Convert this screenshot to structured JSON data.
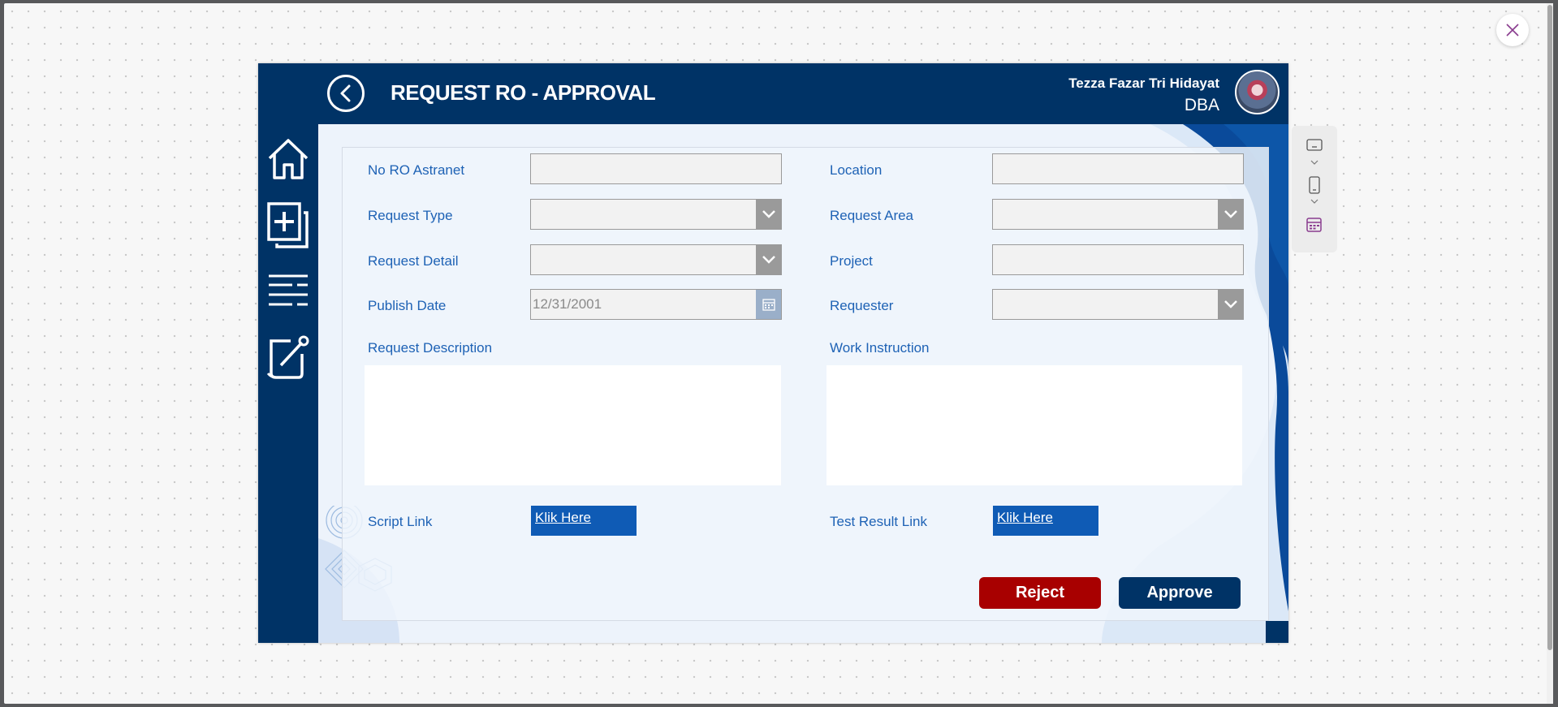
{
  "app": {
    "title": "REQUEST RO - APPROVAL",
    "user_name": "Tezza Fazar Tri Hidayat",
    "user_role": "DBA"
  },
  "form": {
    "no_ro_label": "No RO Astranet",
    "no_ro_value": "",
    "request_type_label": "Request Type",
    "request_detail_label": "Request Detail",
    "publish_date_label": "Publish Date",
    "publish_date_value": "12/31/2001",
    "request_description_label": "Request Description",
    "script_link_label": "Script Link",
    "script_link_text": "Klik Here",
    "location_label": "Location",
    "location_value": "",
    "request_area_label": "Request Area",
    "project_label": "Project",
    "project_value": "",
    "requester_label": "Requester",
    "work_instruction_label": "Work Instruction",
    "test_result_link_label": "Test Result Link",
    "test_result_link_text": "Klik Here"
  },
  "actions": {
    "reject_label": "Reject",
    "approve_label": "Approve"
  },
  "sidebar": {
    "icons": [
      "home-icon",
      "add-document-icon",
      "list-icon",
      "edit-note-icon"
    ]
  },
  "colors": {
    "brand_dark": "#003366",
    "accent_blue": "#0f5bb5",
    "label_blue": "#1e62b5",
    "reject_red": "#a80000"
  }
}
